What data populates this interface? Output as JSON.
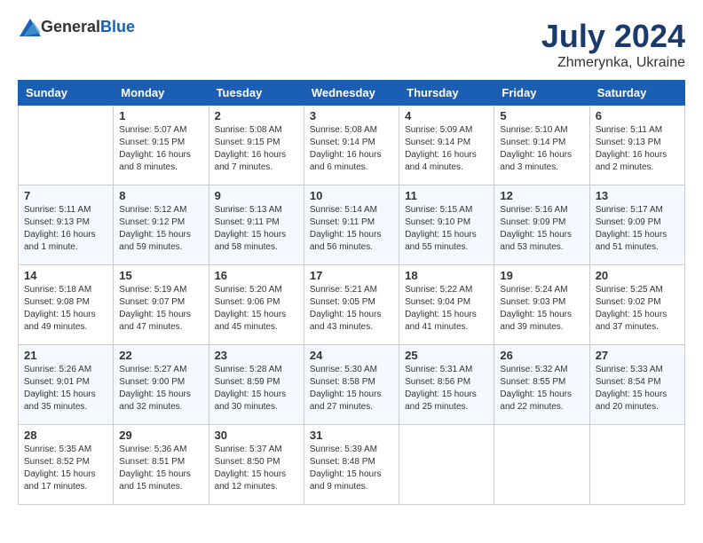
{
  "header": {
    "logo_general": "General",
    "logo_blue": "Blue",
    "month_year": "July 2024",
    "location": "Zhmerynka, Ukraine"
  },
  "days_of_week": [
    "Sunday",
    "Monday",
    "Tuesday",
    "Wednesday",
    "Thursday",
    "Friday",
    "Saturday"
  ],
  "weeks": [
    [
      {
        "day": "",
        "sunrise": "",
        "sunset": "",
        "daylight": ""
      },
      {
        "day": "1",
        "sunrise": "Sunrise: 5:07 AM",
        "sunset": "Sunset: 9:15 PM",
        "daylight": "Daylight: 16 hours and 8 minutes."
      },
      {
        "day": "2",
        "sunrise": "Sunrise: 5:08 AM",
        "sunset": "Sunset: 9:15 PM",
        "daylight": "Daylight: 16 hours and 7 minutes."
      },
      {
        "day": "3",
        "sunrise": "Sunrise: 5:08 AM",
        "sunset": "Sunset: 9:14 PM",
        "daylight": "Daylight: 16 hours and 6 minutes."
      },
      {
        "day": "4",
        "sunrise": "Sunrise: 5:09 AM",
        "sunset": "Sunset: 9:14 PM",
        "daylight": "Daylight: 16 hours and 4 minutes."
      },
      {
        "day": "5",
        "sunrise": "Sunrise: 5:10 AM",
        "sunset": "Sunset: 9:14 PM",
        "daylight": "Daylight: 16 hours and 3 minutes."
      },
      {
        "day": "6",
        "sunrise": "Sunrise: 5:11 AM",
        "sunset": "Sunset: 9:13 PM",
        "daylight": "Daylight: 16 hours and 2 minutes."
      }
    ],
    [
      {
        "day": "7",
        "sunrise": "Sunrise: 5:11 AM",
        "sunset": "Sunset: 9:13 PM",
        "daylight": "Daylight: 16 hours and 1 minute."
      },
      {
        "day": "8",
        "sunrise": "Sunrise: 5:12 AM",
        "sunset": "Sunset: 9:12 PM",
        "daylight": "Daylight: 15 hours and 59 minutes."
      },
      {
        "day": "9",
        "sunrise": "Sunrise: 5:13 AM",
        "sunset": "Sunset: 9:11 PM",
        "daylight": "Daylight: 15 hours and 58 minutes."
      },
      {
        "day": "10",
        "sunrise": "Sunrise: 5:14 AM",
        "sunset": "Sunset: 9:11 PM",
        "daylight": "Daylight: 15 hours and 56 minutes."
      },
      {
        "day": "11",
        "sunrise": "Sunrise: 5:15 AM",
        "sunset": "Sunset: 9:10 PM",
        "daylight": "Daylight: 15 hours and 55 minutes."
      },
      {
        "day": "12",
        "sunrise": "Sunrise: 5:16 AM",
        "sunset": "Sunset: 9:09 PM",
        "daylight": "Daylight: 15 hours and 53 minutes."
      },
      {
        "day": "13",
        "sunrise": "Sunrise: 5:17 AM",
        "sunset": "Sunset: 9:09 PM",
        "daylight": "Daylight: 15 hours and 51 minutes."
      }
    ],
    [
      {
        "day": "14",
        "sunrise": "Sunrise: 5:18 AM",
        "sunset": "Sunset: 9:08 PM",
        "daylight": "Daylight: 15 hours and 49 minutes."
      },
      {
        "day": "15",
        "sunrise": "Sunrise: 5:19 AM",
        "sunset": "Sunset: 9:07 PM",
        "daylight": "Daylight: 15 hours and 47 minutes."
      },
      {
        "day": "16",
        "sunrise": "Sunrise: 5:20 AM",
        "sunset": "Sunset: 9:06 PM",
        "daylight": "Daylight: 15 hours and 45 minutes."
      },
      {
        "day": "17",
        "sunrise": "Sunrise: 5:21 AM",
        "sunset": "Sunset: 9:05 PM",
        "daylight": "Daylight: 15 hours and 43 minutes."
      },
      {
        "day": "18",
        "sunrise": "Sunrise: 5:22 AM",
        "sunset": "Sunset: 9:04 PM",
        "daylight": "Daylight: 15 hours and 41 minutes."
      },
      {
        "day": "19",
        "sunrise": "Sunrise: 5:24 AM",
        "sunset": "Sunset: 9:03 PM",
        "daylight": "Daylight: 15 hours and 39 minutes."
      },
      {
        "day": "20",
        "sunrise": "Sunrise: 5:25 AM",
        "sunset": "Sunset: 9:02 PM",
        "daylight": "Daylight: 15 hours and 37 minutes."
      }
    ],
    [
      {
        "day": "21",
        "sunrise": "Sunrise: 5:26 AM",
        "sunset": "Sunset: 9:01 PM",
        "daylight": "Daylight: 15 hours and 35 minutes."
      },
      {
        "day": "22",
        "sunrise": "Sunrise: 5:27 AM",
        "sunset": "Sunset: 9:00 PM",
        "daylight": "Daylight: 15 hours and 32 minutes."
      },
      {
        "day": "23",
        "sunrise": "Sunrise: 5:28 AM",
        "sunset": "Sunset: 8:59 PM",
        "daylight": "Daylight: 15 hours and 30 minutes."
      },
      {
        "day": "24",
        "sunrise": "Sunrise: 5:30 AM",
        "sunset": "Sunset: 8:58 PM",
        "daylight": "Daylight: 15 hours and 27 minutes."
      },
      {
        "day": "25",
        "sunrise": "Sunrise: 5:31 AM",
        "sunset": "Sunset: 8:56 PM",
        "daylight": "Daylight: 15 hours and 25 minutes."
      },
      {
        "day": "26",
        "sunrise": "Sunrise: 5:32 AM",
        "sunset": "Sunset: 8:55 PM",
        "daylight": "Daylight: 15 hours and 22 minutes."
      },
      {
        "day": "27",
        "sunrise": "Sunrise: 5:33 AM",
        "sunset": "Sunset: 8:54 PM",
        "daylight": "Daylight: 15 hours and 20 minutes."
      }
    ],
    [
      {
        "day": "28",
        "sunrise": "Sunrise: 5:35 AM",
        "sunset": "Sunset: 8:52 PM",
        "daylight": "Daylight: 15 hours and 17 minutes."
      },
      {
        "day": "29",
        "sunrise": "Sunrise: 5:36 AM",
        "sunset": "Sunset: 8:51 PM",
        "daylight": "Daylight: 15 hours and 15 minutes."
      },
      {
        "day": "30",
        "sunrise": "Sunrise: 5:37 AM",
        "sunset": "Sunset: 8:50 PM",
        "daylight": "Daylight: 15 hours and 12 minutes."
      },
      {
        "day": "31",
        "sunrise": "Sunrise: 5:39 AM",
        "sunset": "Sunset: 8:48 PM",
        "daylight": "Daylight: 15 hours and 9 minutes."
      },
      {
        "day": "",
        "sunrise": "",
        "sunset": "",
        "daylight": ""
      },
      {
        "day": "",
        "sunrise": "",
        "sunset": "",
        "daylight": ""
      },
      {
        "day": "",
        "sunrise": "",
        "sunset": "",
        "daylight": ""
      }
    ]
  ]
}
